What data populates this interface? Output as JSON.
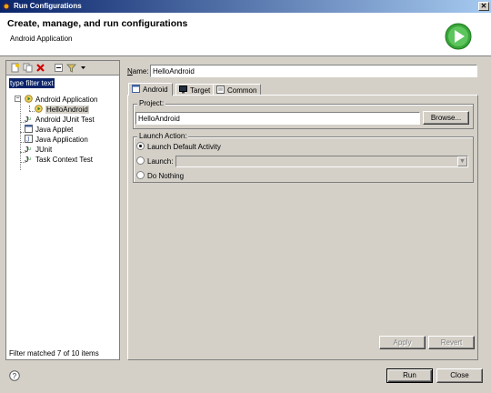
{
  "window": {
    "title": "Run Configurations"
  },
  "banner": {
    "heading": "Create, manage, and run configurations",
    "subheading": "Android Application"
  },
  "left_pane": {
    "toolbar": [
      {
        "name": "new-configuration-icon"
      },
      {
        "name": "duplicate-icon"
      },
      {
        "name": "delete-icon"
      },
      {
        "name": "collapse-all-icon"
      },
      {
        "name": "filter-icon"
      },
      {
        "name": "dropdown-arrow-icon"
      }
    ],
    "filter": {
      "value": "type filter text"
    },
    "tree": [
      {
        "label": "Android Application",
        "icon": "android-app-icon",
        "level": 0,
        "expanded": true
      },
      {
        "label": "HelloAndroid",
        "icon": "android-config-icon",
        "level": 1,
        "selected": true
      },
      {
        "label": "Android JUnit Test",
        "icon": "junit-icon",
        "level": 0
      },
      {
        "label": "Java Applet",
        "icon": "applet-icon",
        "level": 0
      },
      {
        "label": "Java Application",
        "icon": "java-app-icon",
        "level": 0
      },
      {
        "label": "JUnit",
        "icon": "junit-icon",
        "level": 0
      },
      {
        "label": "Task Context Test",
        "icon": "junit-icon",
        "level": 0
      }
    ],
    "status": "Filter matched 7 of 10 items"
  },
  "config": {
    "name_label_prefix": "N",
    "name_label_rest": "ame:",
    "name_value": "HelloAndroid",
    "tabs": [
      {
        "label": "Android",
        "icon": "android-tab-icon",
        "active": true
      },
      {
        "label": "Target",
        "icon": "target-tab-icon",
        "active": false
      },
      {
        "label": "Common",
        "icon": "common-tab-icon",
        "active": false
      }
    ],
    "project": {
      "group_label": "Project:",
      "value": "HelloAndroid",
      "browse_label": "Browse..."
    },
    "launch": {
      "group_label": "Launch Action:",
      "options": [
        {
          "label": "Launch Default Activity",
          "checked": true
        },
        {
          "label": "Launch:",
          "checked": false
        },
        {
          "label": "Do Nothing",
          "checked": false
        }
      ],
      "combo_value": ""
    },
    "apply_label": "Apply",
    "revert_label": "Revert"
  },
  "footer": {
    "run_label": "Run",
    "close_label": "Close"
  },
  "colors": {
    "titlebar_start": "#0a246a",
    "titlebar_end": "#a6caf0",
    "run_icon": "#3aa53a",
    "face": "#d4d0c8"
  }
}
